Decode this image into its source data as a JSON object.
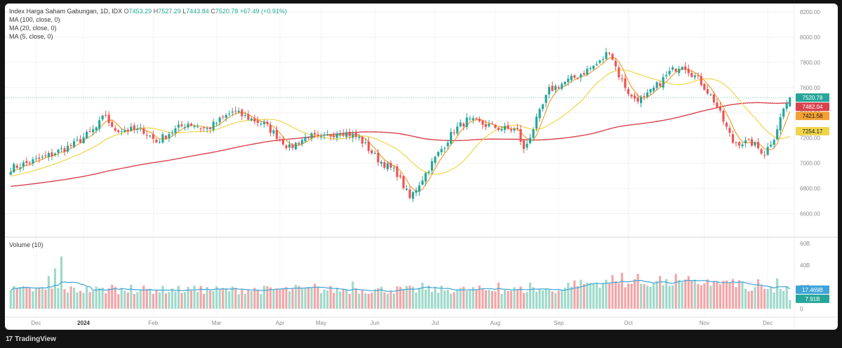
{
  "header": {
    "title": "Index Harga Saham Gabungan, 1D, IDX",
    "open_label": "O",
    "open": "7453.29",
    "high_label": "H",
    "high": "7527.29",
    "low_label": "L",
    "low": "7443.84",
    "close_label": "C",
    "close": "7520.78",
    "change": "+67.49 (+0.91%)",
    "ma_lines": [
      "MA (100, close, 0)",
      "MA (20, close, 0)",
      "MA (5, close, 0)"
    ],
    "volume_title": "Volume (10)"
  },
  "footer": {
    "brand": "TradingView"
  },
  "colors": {
    "up": "#26a69a",
    "down": "#ef5350",
    "vol_up": "#9fd9c9",
    "vol_down": "#f3a5a8",
    "ma100": "#d8434e",
    "ma20": "#f0d54a",
    "ma5": "#f2a033",
    "vol_ma": "#3fa4d8",
    "last_price_badge": "#26a69a"
  },
  "chart_data": [
    {
      "type": "candlestick",
      "title": "Index Harga Saham Gabungan, 1D, IDX",
      "y_ticks": [
        "6600.00",
        "6800.00",
        "7000.00",
        "7200.00",
        "7400.00",
        "7600.00",
        "7800.00",
        "8000.00",
        "8200.00"
      ],
      "ylim": [
        6430,
        8240
      ],
      "x_ticks": [
        "Dec",
        "2024",
        "Feb",
        "Mar",
        "Apr",
        "May",
        "Jun",
        "Jul",
        "Aug",
        "Sep",
        "Oct",
        "Nov",
        "Dec"
      ],
      "x_tick_bars": [
        8,
        23,
        45,
        65,
        85,
        98,
        115,
        134,
        153,
        173,
        195,
        219,
        239
      ],
      "bar_count": 247,
      "anchors": [
        [
          0,
          6960
        ],
        [
          10,
          7040
        ],
        [
          20,
          7150
        ],
        [
          27,
          7280
        ],
        [
          30,
          7390
        ],
        [
          32,
          7270
        ],
        [
          42,
          7260
        ],
        [
          46,
          7170
        ],
        [
          50,
          7240
        ],
        [
          56,
          7320
        ],
        [
          62,
          7270
        ],
        [
          70,
          7410
        ],
        [
          80,
          7310
        ],
        [
          84,
          7220
        ],
        [
          88,
          7120
        ],
        [
          94,
          7220
        ],
        [
          98,
          7190
        ],
        [
          104,
          7260
        ],
        [
          110,
          7200
        ],
        [
          116,
          7030
        ],
        [
          122,
          6920
        ],
        [
          126,
          6720
        ],
        [
          128,
          6800
        ],
        [
          134,
          7040
        ],
        [
          140,
          7260
        ],
        [
          144,
          7340
        ],
        [
          154,
          7280
        ],
        [
          160,
          7260
        ],
        [
          162,
          7100
        ],
        [
          170,
          7580
        ],
        [
          178,
          7680
        ],
        [
          186,
          7800
        ],
        [
          189,
          7900
        ],
        [
          192,
          7700
        ],
        [
          196,
          7520
        ],
        [
          200,
          7510
        ],
        [
          208,
          7720
        ],
        [
          212,
          7790
        ],
        [
          218,
          7640
        ],
        [
          222,
          7500
        ],
        [
          228,
          7170
        ],
        [
          234,
          7160
        ],
        [
          238,
          7080
        ],
        [
          241,
          7210
        ],
        [
          244,
          7430
        ],
        [
          246,
          7521
        ]
      ],
      "series": [
        {
          "name": "MA (100, close, 0)",
          "value_label": "7482.04"
        },
        {
          "name": "MA (20, close, 0)",
          "value_label": "7254.17"
        },
        {
          "name": "MA (5, close, 0)",
          "value_label": "7421.58"
        }
      ],
      "last_price_label": "7520.78"
    },
    {
      "type": "bar",
      "title": "Volume (10)",
      "y_ticks": [
        "0",
        "20B",
        "40B",
        "60B"
      ],
      "ylim": [
        0,
        60
      ],
      "unit": "B",
      "baseline": 17,
      "spikes": [
        [
          12,
          30
        ],
        [
          14,
          37
        ],
        [
          16,
          48
        ],
        [
          32,
          22
        ],
        [
          38,
          22
        ],
        [
          60,
          21
        ],
        [
          90,
          22
        ],
        [
          96,
          23
        ],
        [
          108,
          25
        ],
        [
          130,
          24
        ],
        [
          154,
          24
        ],
        [
          164,
          24
        ],
        [
          176,
          24
        ],
        [
          190,
          31
        ],
        [
          193,
          33
        ],
        [
          198,
          32
        ],
        [
          205,
          30
        ],
        [
          210,
          32
        ],
        [
          214,
          30
        ],
        [
          220,
          27
        ],
        [
          226,
          26
        ],
        [
          236,
          27
        ],
        [
          242,
          28
        ]
      ],
      "series": [
        {
          "name": "Volume (10)",
          "value_label": "17.469B"
        }
      ],
      "last_volume_label": "7.91B"
    }
  ]
}
